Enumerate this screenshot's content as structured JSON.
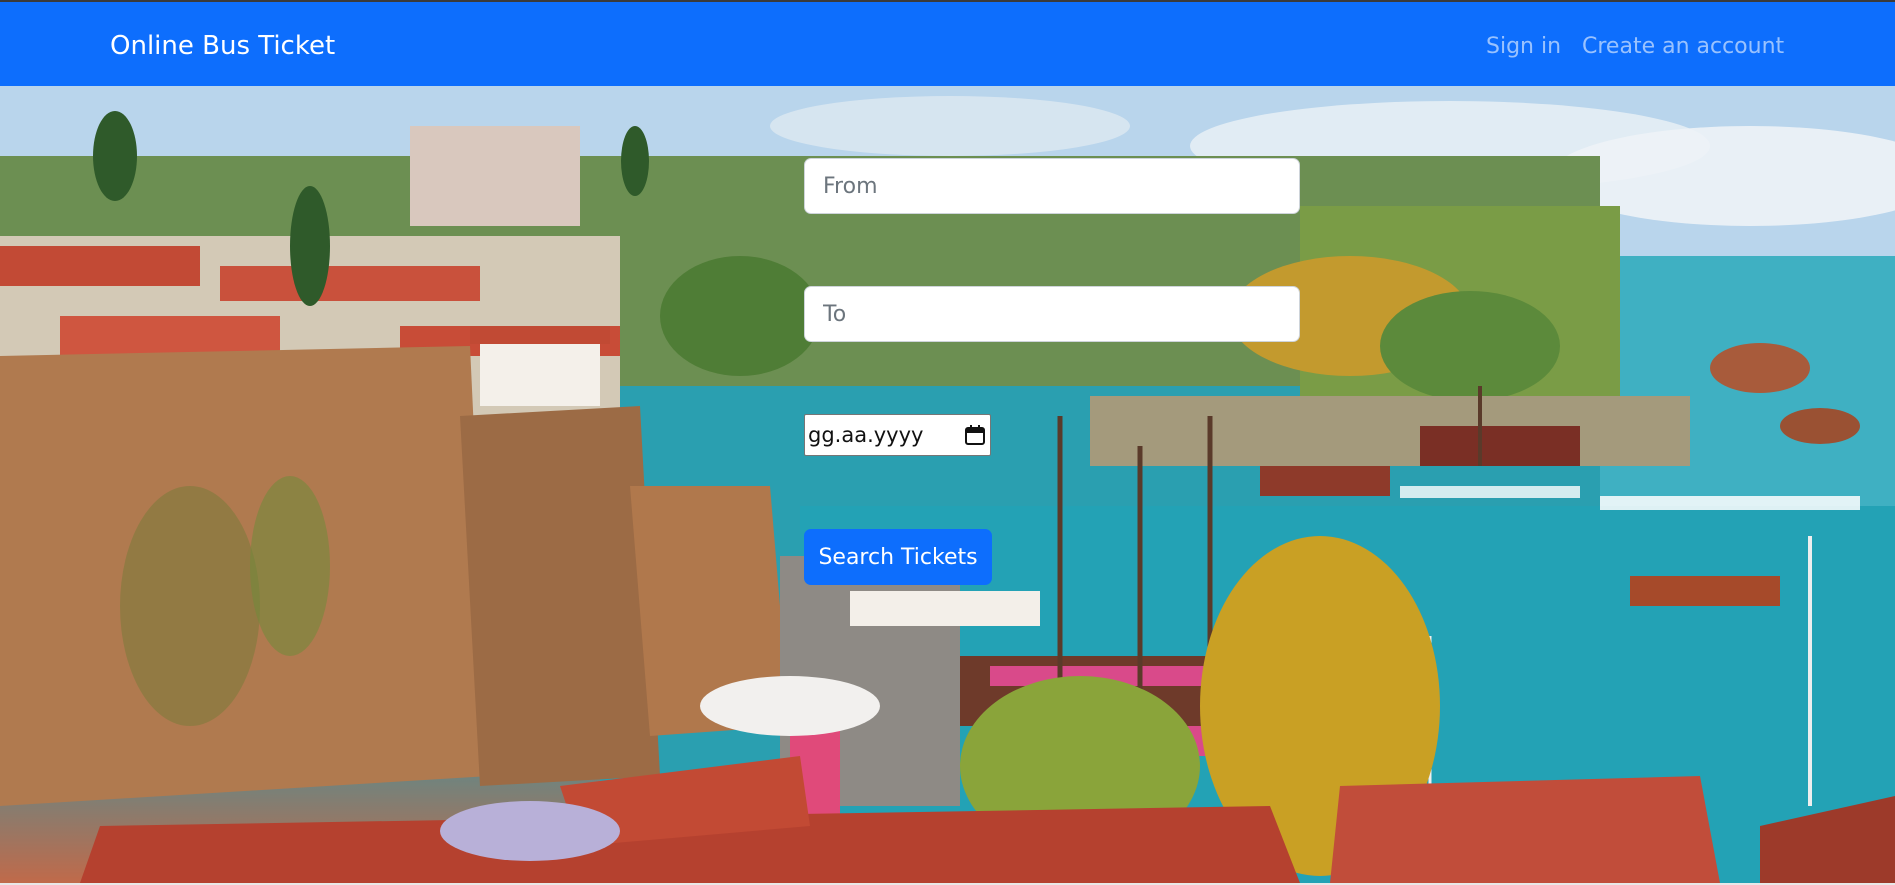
{
  "navbar": {
    "brand": "Online Bus Ticket",
    "links": [
      {
        "label": "Sign in"
      },
      {
        "label": "Create an account"
      }
    ]
  },
  "search_form": {
    "from": {
      "placeholder": "From",
      "value": ""
    },
    "to": {
      "placeholder": "To",
      "value": ""
    },
    "date": {
      "display": "gg.aa.yyyy",
      "icon": "calendar-icon"
    },
    "submit_label": "Search Tickets"
  },
  "hero": {
    "image": "harbor-town-photo"
  },
  "colors": {
    "navbar_bg": "#0d6efd",
    "button_bg": "#0d6efd",
    "nav_link": "rgba(255,255,255,0.55)"
  }
}
